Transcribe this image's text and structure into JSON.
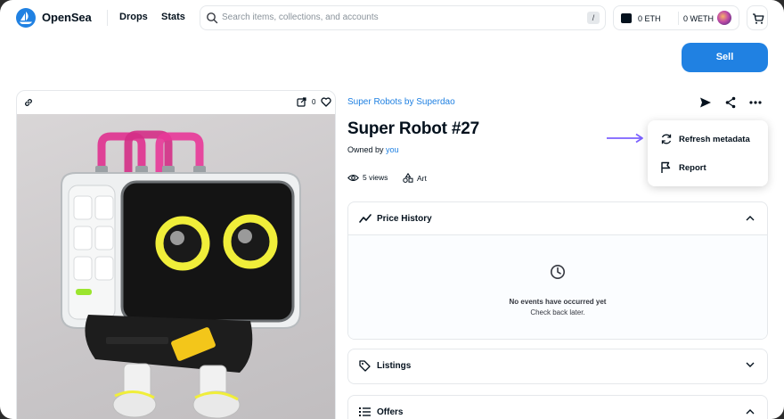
{
  "nav": {
    "brand": "OpenSea",
    "links": [
      "Drops",
      "Stats"
    ],
    "search_placeholder": "Search items, collections, and accounts",
    "search_shortcut": "/",
    "eth_balance": "0 ETH",
    "weth_balance": "0 WETH"
  },
  "sell_button": "Sell",
  "image_card": {
    "favorites_count": "0"
  },
  "item": {
    "collection": "Super Robots by Superdao",
    "title": "Super Robot #27",
    "owned_prefix": "Owned by",
    "owner": "you",
    "views": "5 views",
    "category": "Art"
  },
  "panels": {
    "price_history": {
      "title": "Price History",
      "empty_title": "No events have occurred yet",
      "empty_sub": "Check back later."
    },
    "listings": {
      "title": "Listings"
    },
    "offers": {
      "title": "Offers"
    }
  },
  "menu": {
    "items": [
      {
        "label": "Refresh metadata",
        "icon": "refresh-icon"
      },
      {
        "label": "Report",
        "icon": "flag-icon"
      }
    ]
  },
  "colors": {
    "accent": "#2081e2",
    "annotation_arrow": "#7b61ff",
    "text": "#04111d",
    "border": "#e5e8eb"
  }
}
